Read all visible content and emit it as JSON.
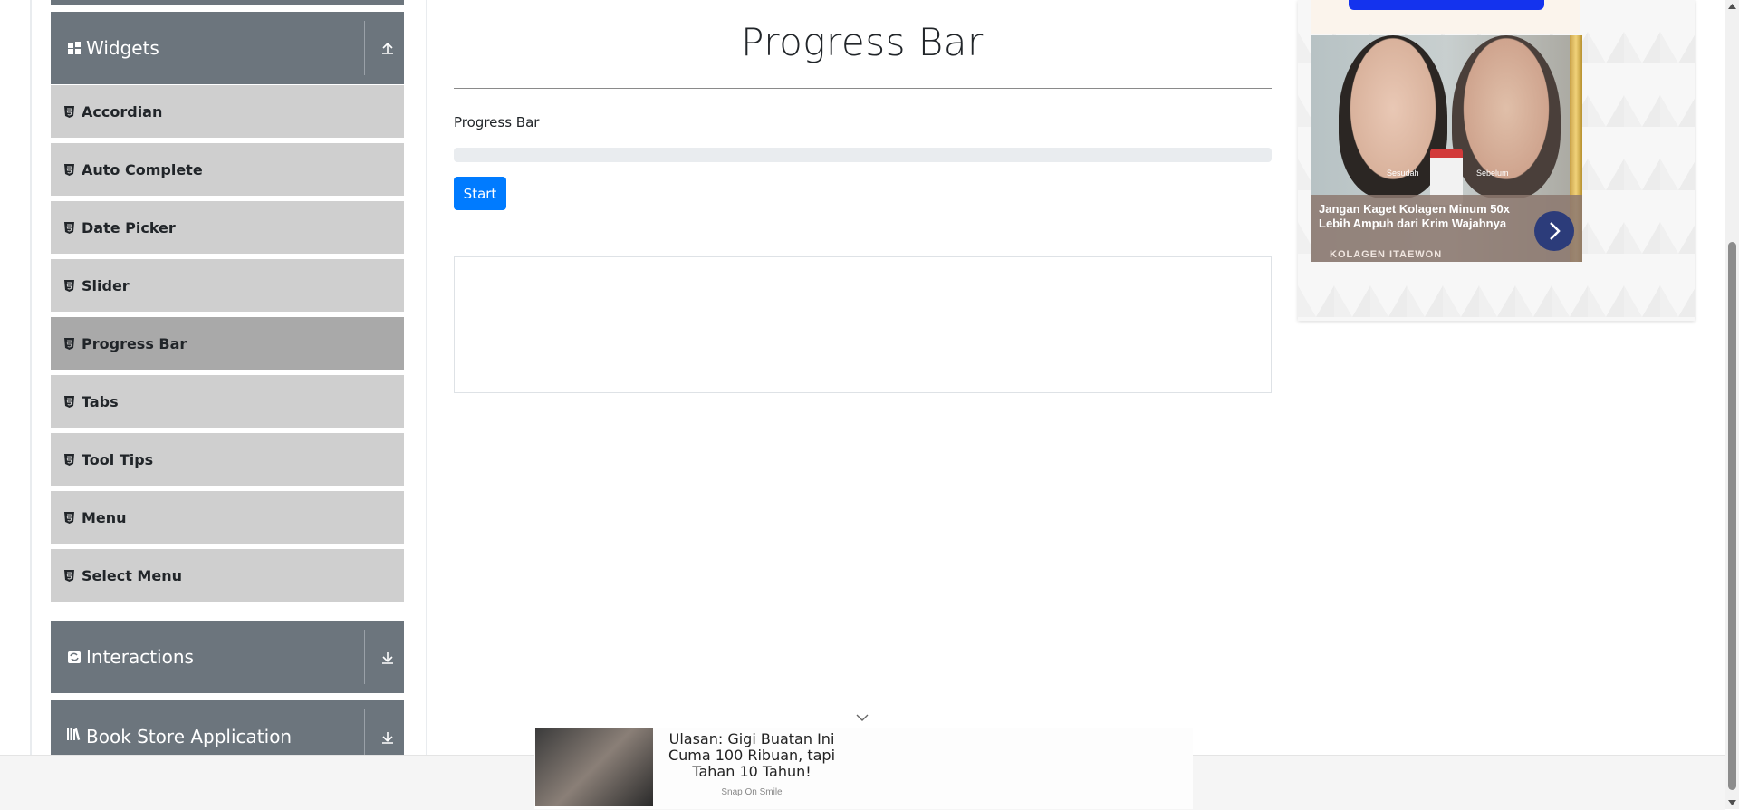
{
  "sidebar": {
    "widgets_header": {
      "title": "Widgets",
      "icon": "widgets-icon",
      "toggle_icon": "collapse-up-icon"
    },
    "widget_items": [
      {
        "label": "Accordian"
      },
      {
        "label": "Auto Complete"
      },
      {
        "label": "Date Picker"
      },
      {
        "label": "Slider"
      },
      {
        "label": "Progress Bar",
        "active": true
      },
      {
        "label": "Tabs"
      },
      {
        "label": "Tool Tips"
      },
      {
        "label": "Menu"
      },
      {
        "label": "Select Menu"
      }
    ],
    "interactions_header": {
      "title": "Interactions",
      "icon": "interactions-icon",
      "toggle_icon": "expand-down-icon"
    },
    "bookstore_header": {
      "title": "Book Store Application",
      "icon": "book-icon",
      "toggle_icon": "expand-down-icon"
    }
  },
  "main": {
    "title": "Progress Bar",
    "progress_label": "Progress Bar",
    "progress_value": 0,
    "start_button": "Start",
    "accent_color": "#007bff"
  },
  "right_ad": {
    "caption_left": "Sesudah",
    "caption_right": "Sebelum",
    "headline": "Jangan Kaget Kolagen Minum 50x Lebih Ampuh dari Krim Wajahnya",
    "brand": "KOLAGEN ITAEWON"
  },
  "bottom_ad": {
    "headline": "Ulasan: Gigi Buatan Ini Cuma 100 Ribuan, tapi Tahan 10 Tahun!",
    "brand": "Snap On Smile"
  }
}
